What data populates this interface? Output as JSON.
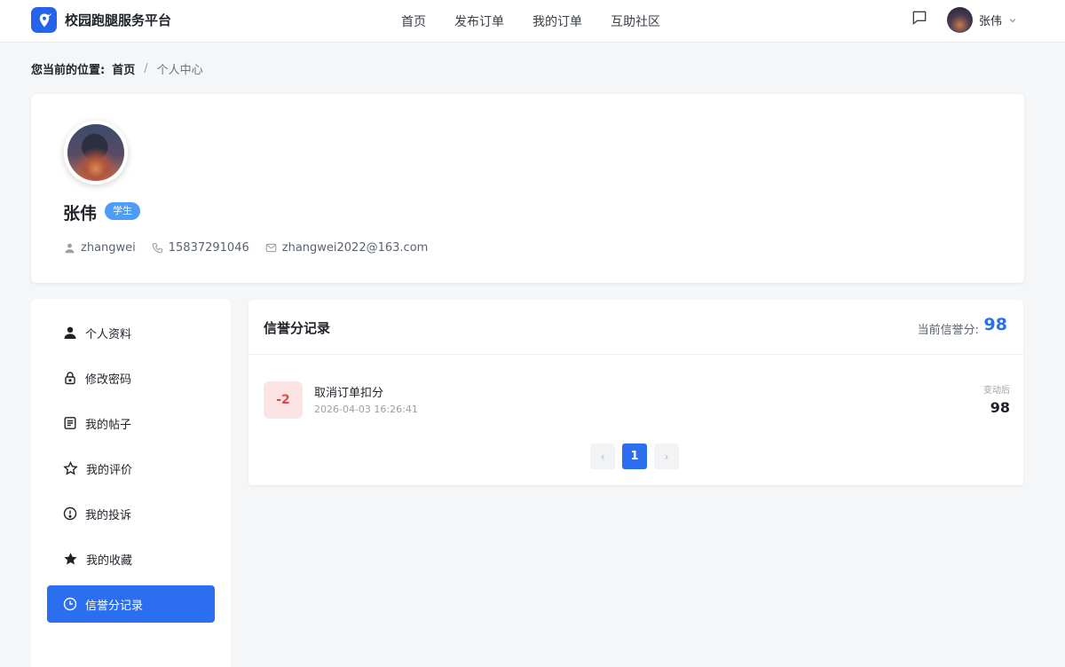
{
  "header": {
    "brand_name": "校园跑腿服务平台",
    "nav": [
      {
        "label": "首页"
      },
      {
        "label": "发布订单"
      },
      {
        "label": "我的订单"
      },
      {
        "label": "互助社区"
      }
    ],
    "user_name": "张伟"
  },
  "breadcrumb": {
    "label": "您当前的位置:",
    "home": "首页",
    "separator": "/",
    "current": "个人中心"
  },
  "profile": {
    "name": "张伟",
    "role": "学生",
    "username": "zhangwei",
    "phone": "15837291046",
    "email": "zhangwei2022@163.com"
  },
  "sidebar": {
    "items": [
      {
        "label": "个人资料",
        "icon": "user-icon",
        "active": false
      },
      {
        "label": "修改密码",
        "icon": "lock-icon",
        "active": false
      },
      {
        "label": "我的帖子",
        "icon": "document-icon",
        "active": false
      },
      {
        "label": "我的评价",
        "icon": "star-outline-icon",
        "active": false
      },
      {
        "label": "我的投诉",
        "icon": "alert-circle-icon",
        "active": false
      },
      {
        "label": "我的收藏",
        "icon": "star-filled-icon",
        "active": false
      },
      {
        "label": "信誉分记录",
        "icon": "clock-icon",
        "active": true
      }
    ]
  },
  "credit": {
    "title": "信誉分记录",
    "current_label": "当前信誉分:",
    "current_score": "98",
    "records": [
      {
        "delta": "-2",
        "reason": "取消订单扣分",
        "time": "2026-04-03 16:26:41",
        "after_label": "变动后",
        "after_score": "98"
      }
    ],
    "pagination": {
      "prev": "‹",
      "current_page": "1",
      "next": "›"
    }
  },
  "colors": {
    "accent": "#2b6ff0",
    "role_badge": "#4e9cf5",
    "negative": "#e24848",
    "negative_bg": "#fde4e4",
    "page_bg": "#f5f6f8"
  }
}
